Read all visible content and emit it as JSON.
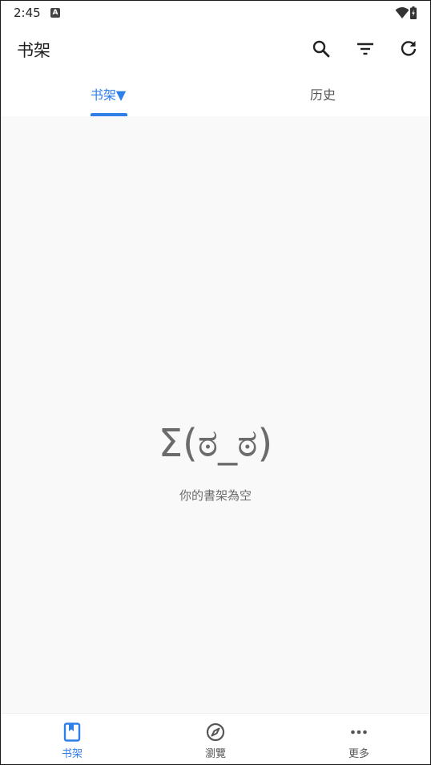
{
  "status_bar": {
    "time": "2:45",
    "notification_badge": "A",
    "icons": [
      "wifi-icon",
      "battery-charging-icon"
    ]
  },
  "app_bar": {
    "title": "书架",
    "actions": [
      "search-icon",
      "filter-icon",
      "refresh-icon"
    ]
  },
  "tabs": [
    {
      "label": "书架▼",
      "selected": true
    },
    {
      "label": "历史",
      "selected": false
    }
  ],
  "empty_state": {
    "face": "Σ(ಠ_ಠ)",
    "message": "你的書架為空"
  },
  "bottom_nav": {
    "items": [
      {
        "label": "书架",
        "icon": "bookmark-book-icon",
        "selected": true
      },
      {
        "label": "瀏覽",
        "icon": "compass-icon",
        "selected": false
      },
      {
        "label": "更多",
        "icon": "more-dots-icon",
        "selected": false
      }
    ]
  },
  "colors": {
    "accent": "#2f7fe9",
    "content_background": "#f9f9f9",
    "muted_text": "#6b6b6b"
  }
}
